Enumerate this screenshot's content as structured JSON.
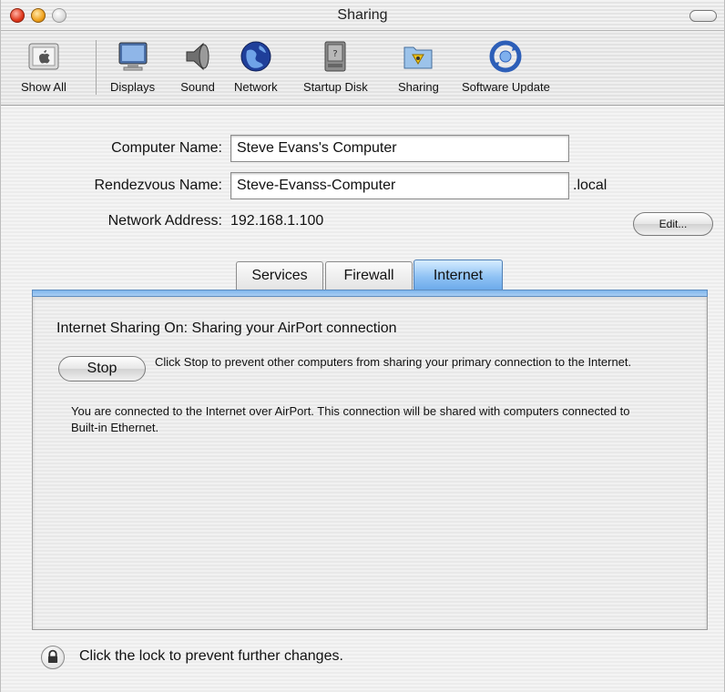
{
  "window": {
    "title": "Sharing"
  },
  "toolbar": {
    "items": [
      {
        "label": "Show All",
        "icon": "apple-icon"
      },
      {
        "label": "Displays",
        "icon": "display-icon"
      },
      {
        "label": "Sound",
        "icon": "speaker-icon"
      },
      {
        "label": "Network",
        "icon": "globe-icon"
      },
      {
        "label": "Startup Disk",
        "icon": "disk-icon"
      },
      {
        "label": "Sharing",
        "icon": "sharing-folder-icon"
      },
      {
        "label": "Software Update",
        "icon": "software-update-icon"
      }
    ]
  },
  "form": {
    "computer_name_label": "Computer Name:",
    "computer_name_value": "Steve Evans's Computer",
    "rendezvous_label": "Rendezvous Name:",
    "rendezvous_value": "Steve-Evanss-Computer",
    "rendezvous_suffix": ".local",
    "network_address_label": "Network Address:",
    "network_address_value": "192.168.1.100",
    "edit_button": "Edit..."
  },
  "tabs": [
    {
      "label": "Services",
      "active": false
    },
    {
      "label": "Firewall",
      "active": false
    },
    {
      "label": "Internet",
      "active": true
    }
  ],
  "internet_panel": {
    "status": "Internet Sharing On: Sharing your AirPort connection",
    "stop_button": "Stop",
    "stop_note": "Click Stop to prevent other computers from sharing your primary connection to the Internet.",
    "info": "You are connected to the Internet over AirPort. This connection will be shared with computers connected to Built-in Ethernet."
  },
  "footer": {
    "lock_text": "Click the lock to prevent further changes."
  },
  "colors": {
    "tab_active": "#8fc2f4",
    "close": "#e0391d",
    "minimize": "#f0a21d"
  }
}
